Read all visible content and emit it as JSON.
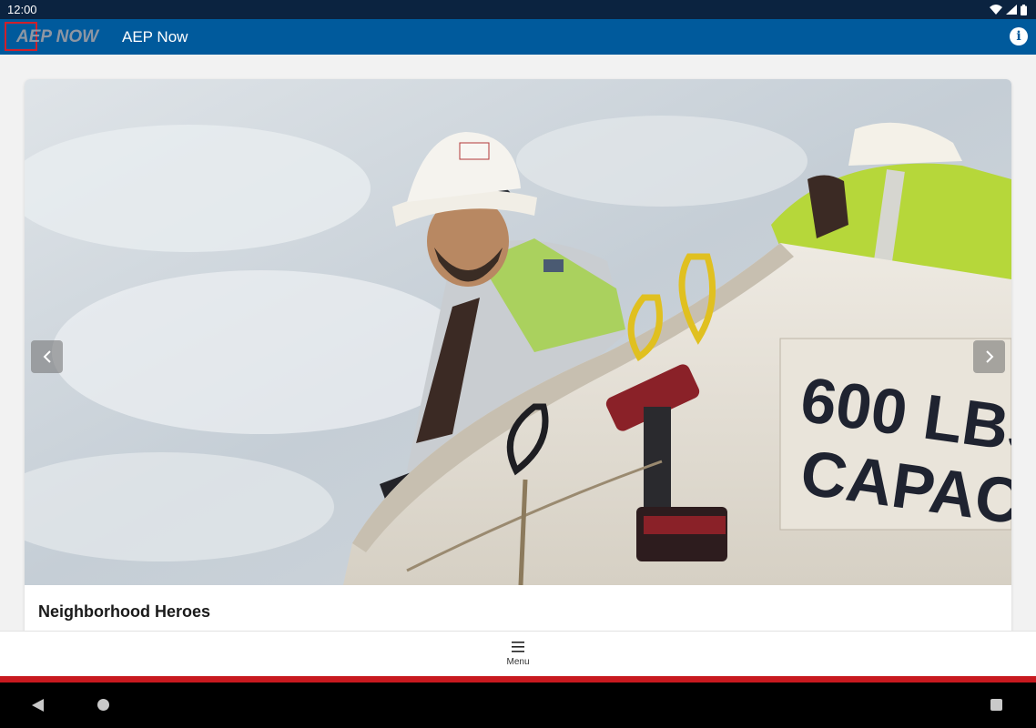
{
  "status_bar": {
    "time": "12:00",
    "icons": [
      "wifi-icon",
      "signal-icon",
      "battery-icon"
    ]
  },
  "app_bar": {
    "logo_text": "AEP NOW",
    "title": "AEP Now",
    "info_icon": "info-icon",
    "colors": {
      "background": "#005a9c",
      "logo_accent": "#d0202a"
    }
  },
  "hero": {
    "image_text": "600 LBS\nCAPACITY",
    "prev_icon": "chevron-left-icon",
    "next_icon": "chevron-right-icon",
    "title": "Neighborhood Heroes"
  },
  "bottom_nav": {
    "menu_label": "Menu",
    "menu_icon": "hamburger-icon",
    "accent": "#c8191f"
  },
  "system_nav": {
    "icons": [
      "back-icon",
      "home-icon",
      "recents-icon"
    ]
  }
}
